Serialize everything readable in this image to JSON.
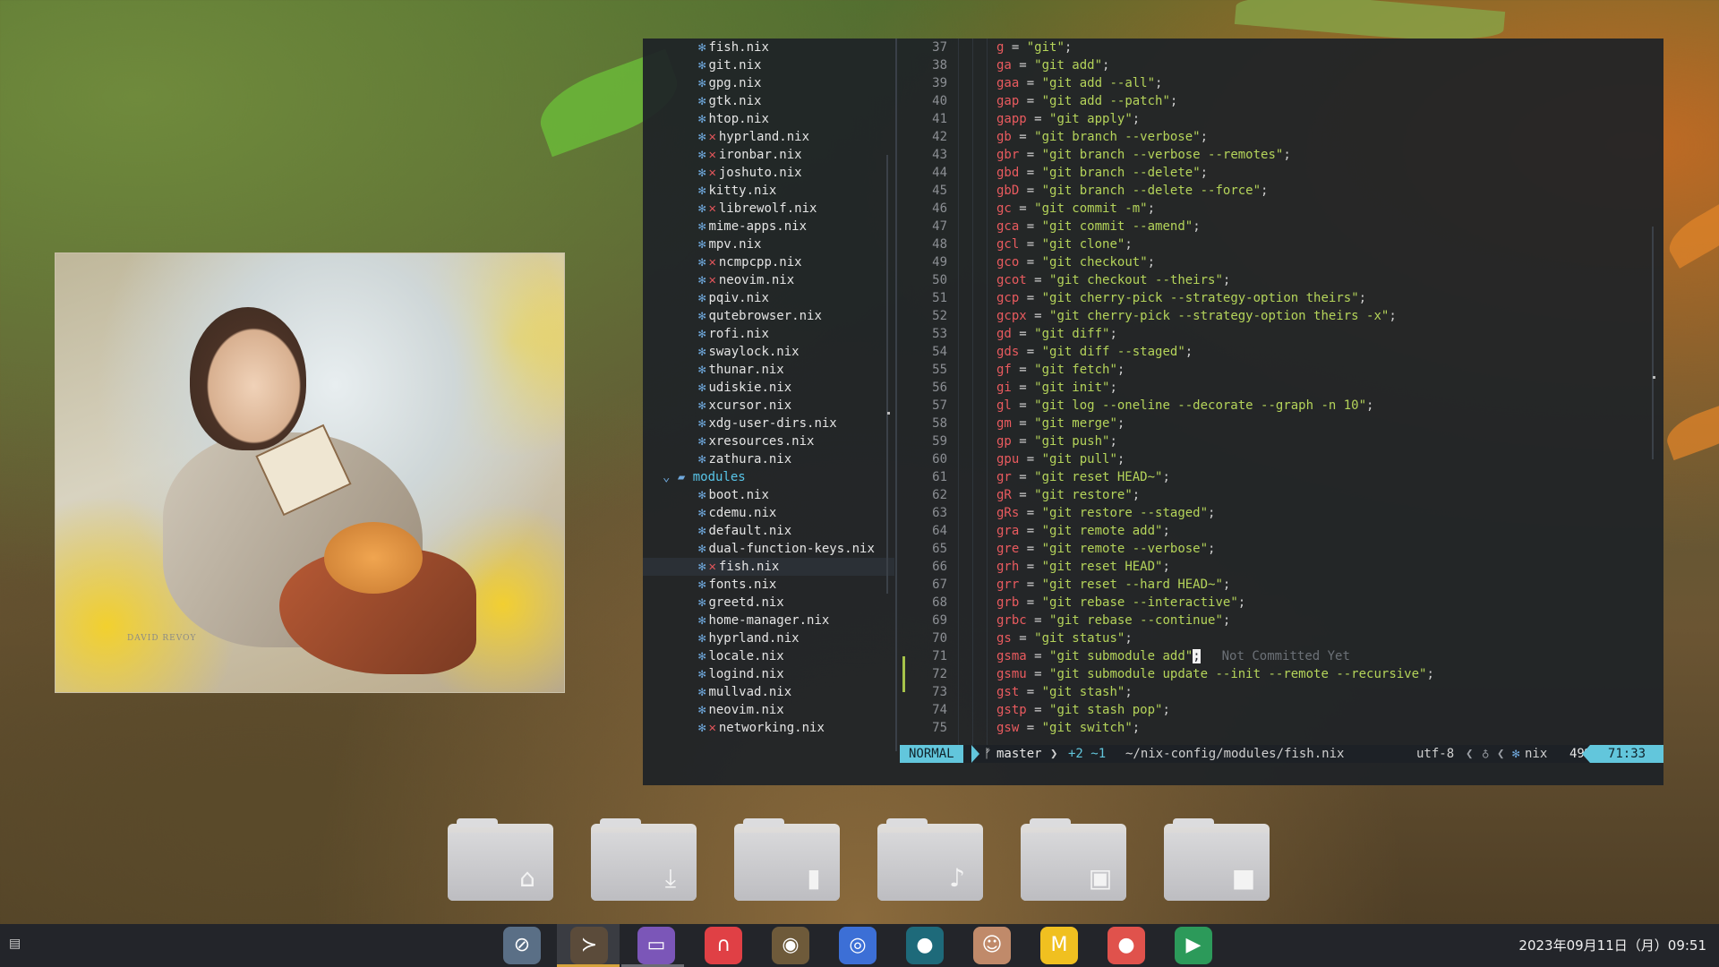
{
  "image_viewer": {
    "signature": "DAVID REVOY"
  },
  "file_tree": {
    "items": [
      {
        "name": "fish.nix",
        "modified": false,
        "selected": false
      },
      {
        "name": "git.nix",
        "modified": false,
        "selected": false
      },
      {
        "name": "gpg.nix",
        "modified": false,
        "selected": false
      },
      {
        "name": "gtk.nix",
        "modified": false,
        "selected": false
      },
      {
        "name": "htop.nix",
        "modified": false,
        "selected": false
      },
      {
        "name": "hyprland.nix",
        "modified": true,
        "selected": false
      },
      {
        "name": "ironbar.nix",
        "modified": true,
        "selected": false
      },
      {
        "name": "joshuto.nix",
        "modified": true,
        "selected": false
      },
      {
        "name": "kitty.nix",
        "modified": false,
        "selected": false
      },
      {
        "name": "librewolf.nix",
        "modified": true,
        "selected": false
      },
      {
        "name": "mime-apps.nix",
        "modified": false,
        "selected": false
      },
      {
        "name": "mpv.nix",
        "modified": false,
        "selected": false
      },
      {
        "name": "ncmpcpp.nix",
        "modified": true,
        "selected": false
      },
      {
        "name": "neovim.nix",
        "modified": true,
        "selected": false
      },
      {
        "name": "pqiv.nix",
        "modified": false,
        "selected": false
      },
      {
        "name": "qutebrowser.nix",
        "modified": false,
        "selected": false
      },
      {
        "name": "rofi.nix",
        "modified": false,
        "selected": false
      },
      {
        "name": "swaylock.nix",
        "modified": false,
        "selected": false
      },
      {
        "name": "thunar.nix",
        "modified": false,
        "selected": false
      },
      {
        "name": "udiskie.nix",
        "modified": false,
        "selected": false
      },
      {
        "name": "xcursor.nix",
        "modified": false,
        "selected": false
      },
      {
        "name": "xdg-user-dirs.nix",
        "modified": false,
        "selected": false
      },
      {
        "name": "xresources.nix",
        "modified": false,
        "selected": false
      },
      {
        "name": "zathura.nix",
        "modified": false,
        "selected": false
      },
      {
        "name": "modules",
        "dir": true,
        "expanded": true
      },
      {
        "name": "boot.nix",
        "modified": false,
        "selected": false
      },
      {
        "name": "cdemu.nix",
        "modified": false,
        "selected": false
      },
      {
        "name": "default.nix",
        "modified": false,
        "selected": false
      },
      {
        "name": "dual-function-keys.nix",
        "modified": false,
        "selected": false
      },
      {
        "name": "fish.nix",
        "modified": true,
        "selected": true
      },
      {
        "name": "fonts.nix",
        "modified": false,
        "selected": false
      },
      {
        "name": "greetd.nix",
        "modified": false,
        "selected": false
      },
      {
        "name": "home-manager.nix",
        "modified": false,
        "selected": false
      },
      {
        "name": "hyprland.nix",
        "modified": false,
        "selected": false
      },
      {
        "name": "locale.nix",
        "modified": false,
        "selected": false
      },
      {
        "name": "logind.nix",
        "modified": false,
        "selected": false
      },
      {
        "name": "mullvad.nix",
        "modified": false,
        "selected": false
      },
      {
        "name": "neovim.nix",
        "modified": false,
        "selected": false
      },
      {
        "name": "networking.nix",
        "modified": true,
        "selected": false
      }
    ]
  },
  "code": {
    "lines": [
      {
        "n": "37",
        "key": "g",
        "val": "git"
      },
      {
        "n": "38",
        "key": "ga",
        "val": "git add"
      },
      {
        "n": "39",
        "key": "gaa",
        "val": "git add --all"
      },
      {
        "n": "40",
        "key": "gap",
        "val": "git add --patch"
      },
      {
        "n": "41",
        "key": "gapp",
        "val": "git apply"
      },
      {
        "n": "42",
        "key": "gb",
        "val": "git branch --verbose"
      },
      {
        "n": "43",
        "key": "gbr",
        "val": "git branch --verbose --remotes"
      },
      {
        "n": "44",
        "key": "gbd",
        "val": "git branch --delete"
      },
      {
        "n": "45",
        "key": "gbD",
        "val": "git branch --delete --force"
      },
      {
        "n": "46",
        "key": "gc",
        "val": "git commit -m"
      },
      {
        "n": "47",
        "key": "gca",
        "val": "git commit --amend"
      },
      {
        "n": "48",
        "key": "gcl",
        "val": "git clone"
      },
      {
        "n": "49",
        "key": "gco",
        "val": "git checkout"
      },
      {
        "n": "50",
        "key": "gcot",
        "val": "git checkout --theirs"
      },
      {
        "n": "51",
        "key": "gcp",
        "val": "git cherry-pick --strategy-option theirs"
      },
      {
        "n": "52",
        "key": "gcpx",
        "val": "git cherry-pick --strategy-option theirs -x"
      },
      {
        "n": "53",
        "key": "gd",
        "val": "git diff"
      },
      {
        "n": "54",
        "key": "gds",
        "val": "git diff --staged"
      },
      {
        "n": "55",
        "key": "gf",
        "val": "git fetch"
      },
      {
        "n": "56",
        "key": "gi",
        "val": "git init"
      },
      {
        "n": "57",
        "key": "gl",
        "val": "git log --oneline --decorate --graph -n 10"
      },
      {
        "n": "58",
        "key": "gm",
        "val": "git merge"
      },
      {
        "n": "59",
        "key": "gp",
        "val": "git push"
      },
      {
        "n": "60",
        "key": "gpu",
        "val": "git pull"
      },
      {
        "n": "61",
        "key": "gr",
        "val": "git reset HEAD~"
      },
      {
        "n": "62",
        "key": "gR",
        "val": "git restore"
      },
      {
        "n": "63",
        "key": "gRs",
        "val": "git restore --staged"
      },
      {
        "n": "64",
        "key": "gra",
        "val": "git remote add"
      },
      {
        "n": "65",
        "key": "gre",
        "val": "git remote --verbose"
      },
      {
        "n": "66",
        "key": "grh",
        "val": "git reset HEAD"
      },
      {
        "n": "67",
        "key": "grr",
        "val": "git reset --hard HEAD~"
      },
      {
        "n": "68",
        "key": "grb",
        "val": "git rebase --interactive"
      },
      {
        "n": "69",
        "key": "grbc",
        "val": "git rebase --continue"
      },
      {
        "n": "70",
        "key": "gs",
        "val": "git status"
      },
      {
        "n": "71",
        "key": "gsma",
        "val": "git submodule add",
        "cursor": true,
        "blame": "Not Committed Yet"
      },
      {
        "n": "72",
        "key": "gsmu",
        "val": "git submodule update --init --remote --recursive"
      },
      {
        "n": "73",
        "key": "gst",
        "val": "git stash"
      },
      {
        "n": "74",
        "key": "gstp",
        "val": "git stash pop"
      },
      {
        "n": "75",
        "key": "gsw",
        "val": "git switch"
      }
    ]
  },
  "statusline": {
    "mode": "NORMAL",
    "branch_icon": "ᚠ",
    "branch": "master",
    "diff": "+2 ~1",
    "path": "~/nix-config/modules/fish.nix",
    "encoding": "utf-8",
    "filetype": "nix",
    "percent": "49%",
    "position": "71:33"
  },
  "desktop_folders": [
    {
      "name": "home-folder",
      "glyph": "⌂"
    },
    {
      "name": "downloads-folder",
      "glyph": "⤓"
    },
    {
      "name": "documents-folder",
      "glyph": "▮"
    },
    {
      "name": "music-folder",
      "glyph": "♪"
    },
    {
      "name": "pictures-folder",
      "glyph": "▣"
    },
    {
      "name": "videos-folder",
      "glyph": "■"
    }
  ],
  "taskbar": {
    "apps": [
      {
        "name": "browser-icon",
        "glyph": "⊘",
        "bg": "#5a6f86"
      },
      {
        "name": "terminal-icon",
        "glyph": "≻",
        "bg": "#5b4b3a"
      },
      {
        "name": "file-manager-icon",
        "glyph": "▭",
        "bg": "#7b56b8"
      },
      {
        "name": "music-player-icon",
        "glyph": "∩",
        "bg": "#e04045"
      },
      {
        "name": "gimp-icon",
        "glyph": "◉",
        "bg": "#6e5a3a"
      },
      {
        "name": "chat-icon",
        "glyph": "◎",
        "bg": "#3c6fd6"
      },
      {
        "name": "audio-icon",
        "glyph": "●",
        "bg": "#1e6a7a"
      },
      {
        "name": "avatar-app-icon",
        "glyph": "☺",
        "bg": "#c08a6a"
      },
      {
        "name": "mail-app-icon",
        "glyph": "M",
        "bg": "#f0c020"
      },
      {
        "name": "recorder-icon",
        "glyph": "●",
        "bg": "#e0524c"
      },
      {
        "name": "media-app-icon",
        "glyph": "▶",
        "bg": "#2c9a5a"
      }
    ],
    "clock": "2023年09月11日（月）09:51"
  }
}
